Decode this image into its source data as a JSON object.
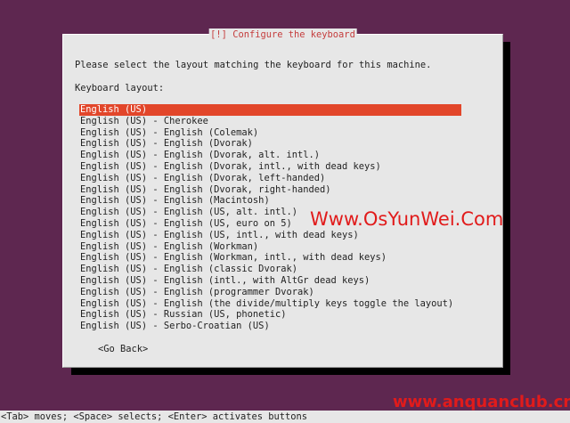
{
  "dialog": {
    "title": "[!] Configure the keyboard",
    "prompt": "Please select the layout matching the keyboard for this machine.",
    "list_label": "Keyboard layout:",
    "layouts": [
      {
        "label": "English (US)",
        "selected": true
      },
      {
        "label": "English (US) - Cherokee"
      },
      {
        "label": "English (US) - English (Colemak)"
      },
      {
        "label": "English (US) - English (Dvorak)"
      },
      {
        "label": "English (US) - English (Dvorak, alt. intl.)"
      },
      {
        "label": "English (US) - English (Dvorak, intl., with dead keys)"
      },
      {
        "label": "English (US) - English (Dvorak, left-handed)"
      },
      {
        "label": "English (US) - English (Dvorak, right-handed)"
      },
      {
        "label": "English (US) - English (Macintosh)"
      },
      {
        "label": "English (US) - English (US, alt. intl.)"
      },
      {
        "label": "English (US) - English (US, euro on 5)"
      },
      {
        "label": "English (US) - English (US, intl., with dead keys)"
      },
      {
        "label": "English (US) - English (Workman)"
      },
      {
        "label": "English (US) - English (Workman, intl., with dead keys)"
      },
      {
        "label": "English (US) - English (classic Dvorak)"
      },
      {
        "label": "English (US) - English (intl., with AltGr dead keys)"
      },
      {
        "label": "English (US) - English (programmer Dvorak)"
      },
      {
        "label": "English (US) - English (the divide/multiply keys toggle the layout)"
      },
      {
        "label": "English (US) - Russian (US, phonetic)"
      },
      {
        "label": "English (US) - Serbo-Croatian (US)"
      }
    ],
    "go_back_label": "<Go Back>"
  },
  "watermarks": {
    "center": "Www.OsYunWei.Com",
    "bottom": "www.anquanclub.cn"
  },
  "footer": {
    "hint": "<Tab> moves; <Space> selects; <Enter> activates buttons"
  },
  "colors": {
    "background": "#5e2750",
    "dialog": "#e7e7e7",
    "selection": "#e2462a",
    "title_text": "#c53d3d",
    "watermark": "#e11b1b"
  }
}
